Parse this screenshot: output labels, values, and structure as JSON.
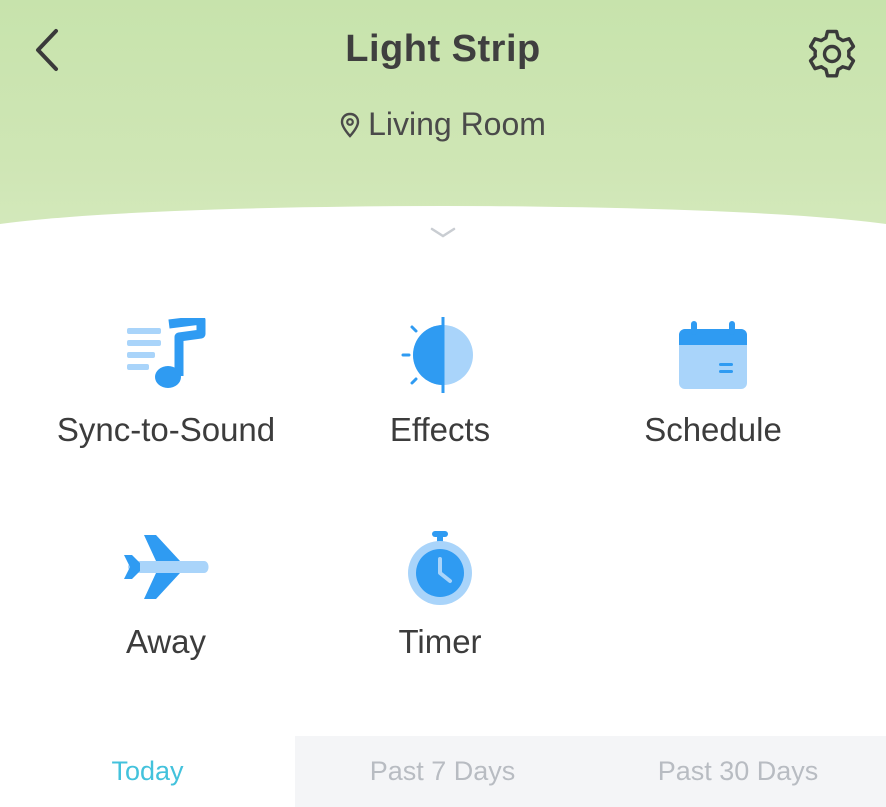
{
  "header": {
    "title": "Light Strip",
    "location": "Living Room",
    "back_icon": "back-chevron-icon",
    "settings_icon": "gear-icon",
    "background_color": "#cfe6b5"
  },
  "features": [
    {
      "id": "sync-to-sound",
      "label": "Sync-to-Sound",
      "icon": "music-note-icon"
    },
    {
      "id": "effects",
      "label": "Effects",
      "icon": "half-sun-icon"
    },
    {
      "id": "schedule",
      "label": "Schedule",
      "icon": "calendar-icon"
    },
    {
      "id": "away",
      "label": "Away",
      "icon": "airplane-icon"
    },
    {
      "id": "timer",
      "label": "Timer",
      "icon": "stopwatch-icon"
    }
  ],
  "tabs": [
    {
      "label": "Today",
      "active": true
    },
    {
      "label": "Past 7 Days",
      "active": false
    },
    {
      "label": "Past 30 Days",
      "active": false
    }
  ],
  "colors": {
    "accent_icon": "#2f9bf2",
    "active_tab": "#43c2dc"
  }
}
